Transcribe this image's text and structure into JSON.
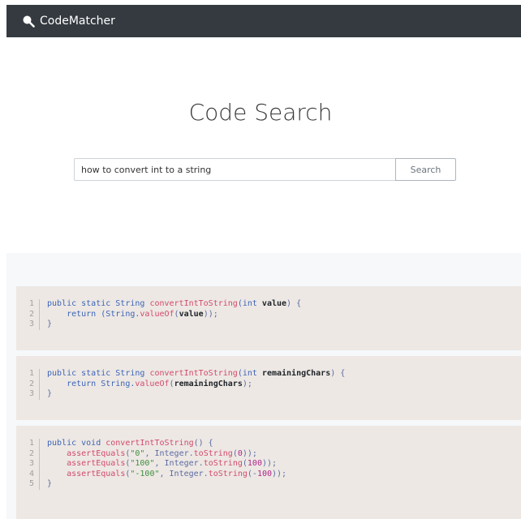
{
  "navbar": {
    "brand": "CodeMatcher"
  },
  "page": {
    "title": "Code Search"
  },
  "search": {
    "value": "how to convert int to a string",
    "button_label": "Search"
  },
  "results": [
    {
      "line_numbers": [
        "1",
        "2",
        "3"
      ],
      "lines": [
        [
          "public static String ",
          "convertIntToString",
          "(int ",
          "value",
          ") {"
        ],
        [
          "    return (String.",
          "valueOf",
          "(",
          "value",
          "));"
        ],
        [
          "}"
        ]
      ]
    },
    {
      "line_numbers": [
        "1",
        "2",
        "3"
      ],
      "lines": [
        [
          "public static String ",
          "convertIntToString",
          "(int ",
          "remainingChars",
          ") {"
        ],
        [
          "    return String.",
          "valueOf",
          "(",
          "remainingChars",
          ");"
        ],
        [
          "}"
        ]
      ]
    },
    {
      "line_numbers": [
        "1",
        "2",
        "3",
        "4",
        "5"
      ],
      "lines": [
        [
          "public void ",
          "convertIntToString",
          "() {"
        ],
        [
          "    ",
          "assertEquals",
          "(",
          "\"0\"",
          ", Integer.",
          "toString",
          "(",
          "0",
          "));"
        ],
        [
          "    ",
          "assertEquals",
          "(",
          "\"100\"",
          ", Integer.",
          "toString",
          "(",
          "100",
          "));"
        ],
        [
          "    ",
          "assertEquals",
          "(",
          "\"-100\"",
          ", Integer.",
          "toString",
          "(-",
          "100",
          "));"
        ],
        [
          "}"
        ]
      ]
    }
  ],
  "colors": {
    "navbar": "#343a40",
    "keyword": "#3d64b8",
    "function": "#d24a6b",
    "string": "#3f8f3f",
    "number": "#b0258a",
    "code_bg": "#ede8e4",
    "results_bg": "#f6f8fa"
  }
}
